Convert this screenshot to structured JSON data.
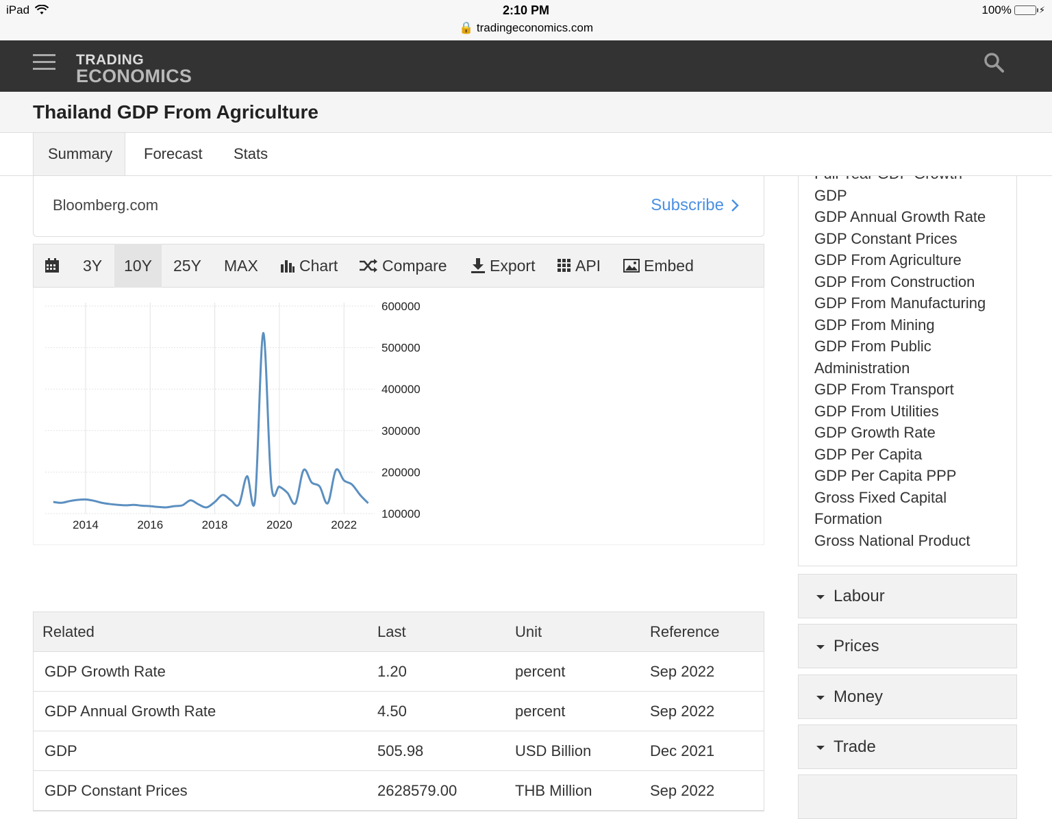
{
  "status_bar": {
    "device": "iPad",
    "time": "2:10 PM",
    "url": "tradingeconomics.com",
    "battery": "100%"
  },
  "nav": {
    "logo_line1": "TRADING",
    "logo_line2": "ECONOMICS"
  },
  "page_title": "Thailand GDP From Agriculture",
  "tabs": [
    {
      "label": "Summary"
    },
    {
      "label": "Forecast"
    },
    {
      "label": "Stats"
    }
  ],
  "source_box": {
    "source": "Bloomberg.com",
    "subscribe": "Subscribe"
  },
  "toolbar": {
    "y3": "3Y",
    "y10": "10Y",
    "y25": "25Y",
    "max": "MAX",
    "chart": "Chart",
    "compare": "Compare",
    "export": "Export",
    "api": "API",
    "embed": "Embed"
  },
  "chart_data": {
    "type": "line",
    "title": "",
    "xlabel": "",
    "ylabel": "",
    "x_ticks": [
      "2014",
      "2016",
      "2018",
      "2020",
      "2022"
    ],
    "y_ticks": [
      "600000",
      "500000",
      "400000",
      "300000",
      "200000",
      "100000"
    ],
    "ylim": [
      100000,
      600000
    ],
    "xlim": [
      2012.75,
      2022.95
    ],
    "grid": true,
    "series": [
      {
        "x": [
          2013.0,
          2013.25,
          2013.5,
          2013.75,
          2014.0,
          2014.25,
          2014.5,
          2014.75,
          2015.0,
          2015.25,
          2015.5,
          2015.75,
          2016.0,
          2016.25,
          2016.5,
          2016.75,
          2017.0,
          2017.25,
          2017.5,
          2017.75,
          2018.0,
          2018.25,
          2018.5,
          2018.75,
          2019.0,
          2019.25,
          2019.5,
          2019.75,
          2020.0,
          2020.25,
          2020.5,
          2020.75,
          2021.0,
          2021.25,
          2021.5,
          2021.75,
          2022.0,
          2022.25,
          2022.5,
          2022.75
        ],
        "y": [
          128000,
          126000,
          130000,
          133000,
          134000,
          131000,
          126000,
          123000,
          121000,
          120000,
          121000,
          119000,
          118000,
          116000,
          115000,
          118000,
          120000,
          132000,
          122000,
          115000,
          128000,
          145000,
          132000,
          122000,
          190000,
          135000,
          535000,
          170000,
          165000,
          150000,
          125000,
          205000,
          175000,
          165000,
          125000,
          205000,
          180000,
          170000,
          145000,
          125000
        ]
      }
    ]
  },
  "related_table": {
    "headers": {
      "related": "Related",
      "last": "Last",
      "unit": "Unit",
      "reference": "Reference"
    },
    "rows": [
      {
        "name": "GDP Growth Rate",
        "last": "1.20",
        "unit": "percent",
        "ref": "Sep 2022"
      },
      {
        "name": "GDP Annual Growth Rate",
        "last": "4.50",
        "unit": "percent",
        "ref": "Sep 2022"
      },
      {
        "name": "GDP",
        "last": "505.98",
        "unit": "USD Billion",
        "ref": "Dec 2021"
      },
      {
        "name": "GDP Constant Prices",
        "last": "2628579.00",
        "unit": "THB Million",
        "ref": "Sep 2022"
      }
    ]
  },
  "sidebar": {
    "items": [
      "Full Year GDP Growth",
      "GDP",
      "GDP Annual Growth Rate",
      "GDP Constant Prices",
      "GDP From Agriculture",
      "GDP From Construction",
      "GDP From Manufacturing",
      "GDP From Mining",
      "GDP From Public",
      "Administration",
      "GDP From Transport",
      "GDP From Utilities",
      "GDP Growth Rate",
      "GDP Per Capita",
      "GDP Per Capita PPP",
      "Gross Fixed Capital",
      "Formation",
      "Gross National Product"
    ],
    "sections": [
      {
        "label": "Labour"
      },
      {
        "label": "Prices"
      },
      {
        "label": "Money"
      },
      {
        "label": "Trade"
      }
    ]
  }
}
